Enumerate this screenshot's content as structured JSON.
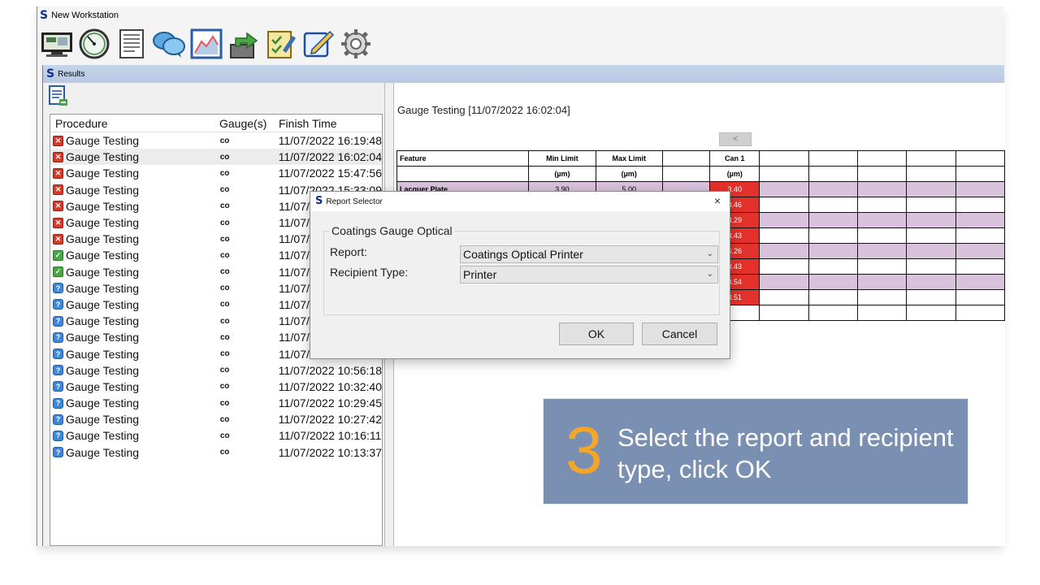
{
  "window": {
    "title": "New Workstation"
  },
  "toolbar": {
    "icons": [
      "monitor-icon",
      "gauge-dial-icon",
      "readings-list-icon",
      "chat-icon",
      "chart-icon",
      "export-icon",
      "checklist-icon",
      "edit-icon",
      "settings-gear-icon"
    ]
  },
  "results": {
    "title": "Results",
    "columns": {
      "procedure": "Procedure",
      "gauges": "Gauge(s)",
      "finish_time": "Finish Time"
    },
    "rows": [
      {
        "status": "fail",
        "procedure": "Gauge Testing",
        "gauge": "co",
        "time": "11/07/2022 16:19:48"
      },
      {
        "status": "fail",
        "procedure": "Gauge Testing",
        "gauge": "co",
        "time": "11/07/2022 16:02:04"
      },
      {
        "status": "fail",
        "procedure": "Gauge Testing",
        "gauge": "co",
        "time": "11/07/2022 15:47:56"
      },
      {
        "status": "fail",
        "procedure": "Gauge Testing",
        "gauge": "co",
        "time": "11/07/2022 15:33:09"
      },
      {
        "status": "fail",
        "procedure": "Gauge Testing",
        "gauge": "co",
        "time": "11/07/"
      },
      {
        "status": "fail",
        "procedure": "Gauge Testing",
        "gauge": "co",
        "time": "11/07/"
      },
      {
        "status": "fail",
        "procedure": "Gauge Testing",
        "gauge": "co",
        "time": "11/07/"
      },
      {
        "status": "pass",
        "procedure": "Gauge Testing",
        "gauge": "co",
        "time": "11/07/"
      },
      {
        "status": "pass",
        "procedure": "Gauge Testing",
        "gauge": "co",
        "time": "11/07/"
      },
      {
        "status": "pending",
        "procedure": "Gauge Testing",
        "gauge": "co",
        "time": "11/07/"
      },
      {
        "status": "pending",
        "procedure": "Gauge Testing",
        "gauge": "co",
        "time": "11/07/"
      },
      {
        "status": "pending",
        "procedure": "Gauge Testing",
        "gauge": "co",
        "time": "11/07/"
      },
      {
        "status": "pending",
        "procedure": "Gauge Testing",
        "gauge": "co",
        "time": "11/07/"
      },
      {
        "status": "pending",
        "procedure": "Gauge Testing",
        "gauge": "co",
        "time": "11/07/"
      },
      {
        "status": "pending",
        "procedure": "Gauge Testing",
        "gauge": "co",
        "time": "11/07/2022 10:56:18"
      },
      {
        "status": "pending",
        "procedure": "Gauge Testing",
        "gauge": "co",
        "time": "11/07/2022 10:32:40"
      },
      {
        "status": "pending",
        "procedure": "Gauge Testing",
        "gauge": "co",
        "time": "11/07/2022 10:29:45"
      },
      {
        "status": "pending",
        "procedure": "Gauge Testing",
        "gauge": "co",
        "time": "11/07/2022 10:27:42"
      },
      {
        "status": "pending",
        "procedure": "Gauge Testing",
        "gauge": "co",
        "time": "11/07/2022 10:16:11"
      },
      {
        "status": "pending",
        "procedure": "Gauge Testing",
        "gauge": "co",
        "time": "11/07/2022 10:13:37"
      }
    ],
    "selected_index": 1
  },
  "detail": {
    "title": "Gauge Testing [11/07/2022 16:02:04]",
    "prev_label": "<",
    "grid": {
      "headers": [
        "Feature",
        "Min Limit",
        "Max Limit",
        "",
        "Can 1"
      ],
      "units": [
        "",
        "(µm)",
        "(µm)",
        "",
        "(µm)"
      ],
      "feature": "Lacquer Plate",
      "min": "3.90",
      "max": "5.00",
      "can_values": [
        "3.40",
        "3.46",
        "3.29",
        "3.43",
        "3.26",
        "3.43",
        "3.54",
        "3.51"
      ]
    }
  },
  "dialog": {
    "title": "Report Selector",
    "close_glyph": "×",
    "group_label": "Coatings Gauge Optical",
    "report_label": "Report:",
    "report_value": "Coatings Optical Printer",
    "recipient_label": "Recipient Type:",
    "recipient_value": "Printer",
    "ok_label": "OK",
    "cancel_label": "Cancel"
  },
  "callout": {
    "step": "3",
    "text": "Select the report and recipient type, click OK"
  },
  "colors": {
    "fail": "#d43a2a",
    "pass": "#4aa546",
    "pending": "#3f86d6",
    "highlight": "#d9261c",
    "callout_bg": "#7a90b2",
    "callout_step": "#f3a62a",
    "row_lavender": "#d8c2dc",
    "cell_red": "#e4312b"
  }
}
